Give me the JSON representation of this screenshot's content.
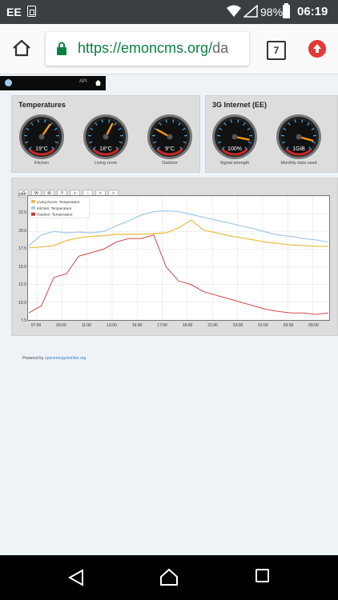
{
  "status": {
    "carrier": "EE",
    "battery": "98%",
    "time": "06:19"
  },
  "browser": {
    "url_host": "https://emoncms.org/",
    "url_path": "da",
    "tab_count": "7"
  },
  "topnav": {
    "api": "API"
  },
  "panels": {
    "temperatures": {
      "title": "Temperatures",
      "gauges": [
        {
          "value": "19°C",
          "label": "Kitchen"
        },
        {
          "value": "18°C",
          "label": "Living room"
        },
        {
          "value": "9°C",
          "label": "Outdoor"
        }
      ]
    },
    "internet": {
      "title": "3G Internet (EE)",
      "gauges": [
        {
          "value": "100%",
          "label": "Signal strength"
        },
        {
          "value": "1GiB",
          "label": "Monthly data used"
        }
      ]
    }
  },
  "zoom_buttons": [
    "D",
    "W",
    "M",
    "Y",
    "+",
    "-",
    "<",
    ">"
  ],
  "chart_data": {
    "type": "line",
    "legend": [
      "Living Room: Temperature",
      "Kitchen: Temperature",
      "Outdoor: Temperature"
    ],
    "colors": [
      "#e8c04a",
      "#a8cbe8",
      "#cc3333"
    ],
    "x_ticks": [
      "07:00",
      "09:00",
      "11:00",
      "13:00",
      "15:00",
      "17:00",
      "19:00",
      "21:00",
      "23:00",
      "01:00",
      "03:00",
      "05:00"
    ],
    "ylim": [
      7.5,
      25.0
    ],
    "y_ticks": [
      "25.0",
      "22.5",
      "20.0",
      "17.5",
      "15.0",
      "12.5",
      "10.0",
      "7.5"
    ],
    "x": [
      0,
      1,
      2,
      3,
      4,
      5,
      6,
      7,
      8,
      9,
      10,
      11,
      12,
      13,
      14,
      15,
      16,
      17,
      18,
      19,
      20,
      21,
      22,
      23,
      24
    ],
    "series": [
      {
        "name": "Living Room: Temperature",
        "values": [
          17.7,
          17.8,
          18.0,
          18.7,
          19.1,
          19.3,
          19.4,
          19.6,
          19.6,
          19.6,
          19.7,
          19.8,
          20.5,
          21.6,
          20.2,
          19.8,
          19.4,
          19.1,
          18.8,
          18.5,
          18.3,
          18.1,
          18.0,
          17.9,
          17.9
        ]
      },
      {
        "name": "Kitchen: Temperature",
        "values": [
          18.0,
          19.5,
          20.0,
          19.8,
          19.9,
          19.8,
          20.0,
          20.8,
          21.5,
          22.3,
          22.8,
          22.9,
          22.8,
          22.4,
          22.0,
          21.6,
          21.2,
          20.8,
          20.4,
          19.9,
          19.5,
          19.3,
          19.0,
          18.8,
          18.5
        ]
      },
      {
        "name": "Outdoor: Temperature",
        "values": [
          8.5,
          9.5,
          13.5,
          14.0,
          16.5,
          17.0,
          17.5,
          18.5,
          19.0,
          19.0,
          19.5,
          15.0,
          13.0,
          12.5,
          11.5,
          11.0,
          10.5,
          10.0,
          9.5,
          9.0,
          8.7,
          8.5,
          8.5,
          8.3,
          8.5
        ]
      }
    ]
  },
  "footer": {
    "prefix": "Powered by ",
    "link": "openenergymonitor.org"
  }
}
